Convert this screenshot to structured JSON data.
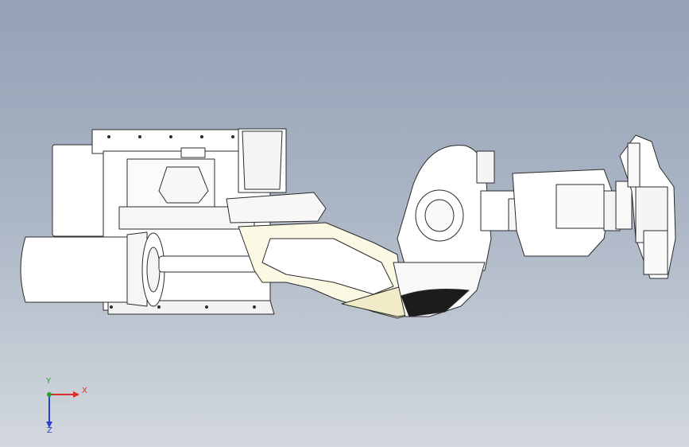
{
  "triad": {
    "x_label": "X",
    "y_label": "Y",
    "z_label": "Z"
  },
  "colors": {
    "x_axis": "#d92b2b",
    "y_axis": "#2aa02a",
    "z_axis": "#2a3fc9",
    "part_fill": "#ffffff",
    "shadow_fill": "#f4f1d8",
    "edge": "#2b2b2b"
  }
}
